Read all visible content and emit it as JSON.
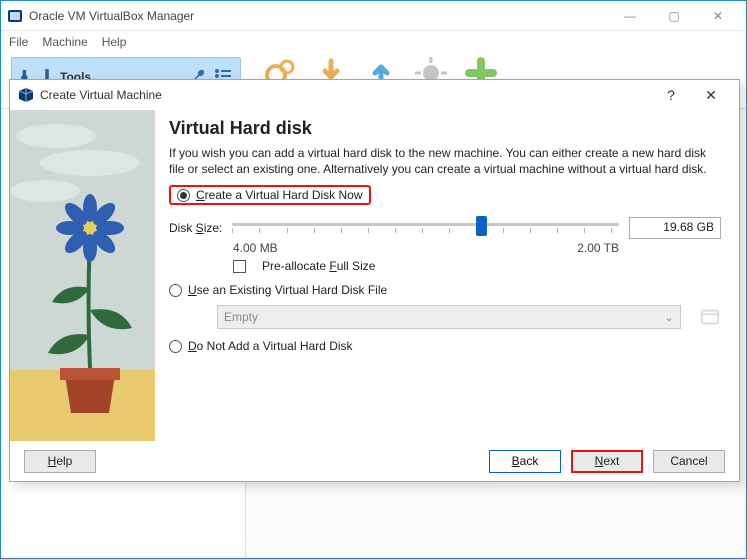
{
  "window": {
    "title": "Oracle VM VirtualBox Manager",
    "menu": {
      "file": "File",
      "machine": "Machine",
      "help": "Help"
    },
    "tools_label": "Tools"
  },
  "dialog": {
    "title": "Create Virtual Machine",
    "help_symbol": "?",
    "close_symbol": "✕",
    "heading": "Virtual Hard disk",
    "description": "If you wish you can add a virtual hard disk to the new machine. You can either create a new hard disk file or select an existing one. Alternatively you can create a virtual machine without a virtual hard disk.",
    "options": {
      "create_now": {
        "pre": "",
        "u": "C",
        "post": "reate a Virtual Hard Disk Now",
        "checked": true
      },
      "use_existing": {
        "pre": "",
        "u": "U",
        "post": "se an Existing Virtual Hard Disk File",
        "checked": false
      },
      "do_not_add": {
        "pre": "",
        "u": "D",
        "post": "o Not Add a Virtual Hard Disk",
        "checked": false
      }
    },
    "disk_size": {
      "label_pre": "Disk ",
      "label_u": "S",
      "label_post": "ize:",
      "min_label": "4.00 MB",
      "max_label": "2.00 TB",
      "value": "19.68 GB",
      "thumb_pct": 63
    },
    "preallocate": {
      "pre": "Pre-allocate ",
      "u": "F",
      "post": "ull Size",
      "checked": false
    },
    "existing_combo": {
      "value": "Empty",
      "enabled": false
    },
    "buttons": {
      "help": {
        "u": "H",
        "post": "elp"
      },
      "back": {
        "u": "B",
        "post": "ack"
      },
      "next": {
        "u": "N",
        "post": "ext"
      },
      "cancel": {
        "text": "Cancel"
      }
    }
  }
}
